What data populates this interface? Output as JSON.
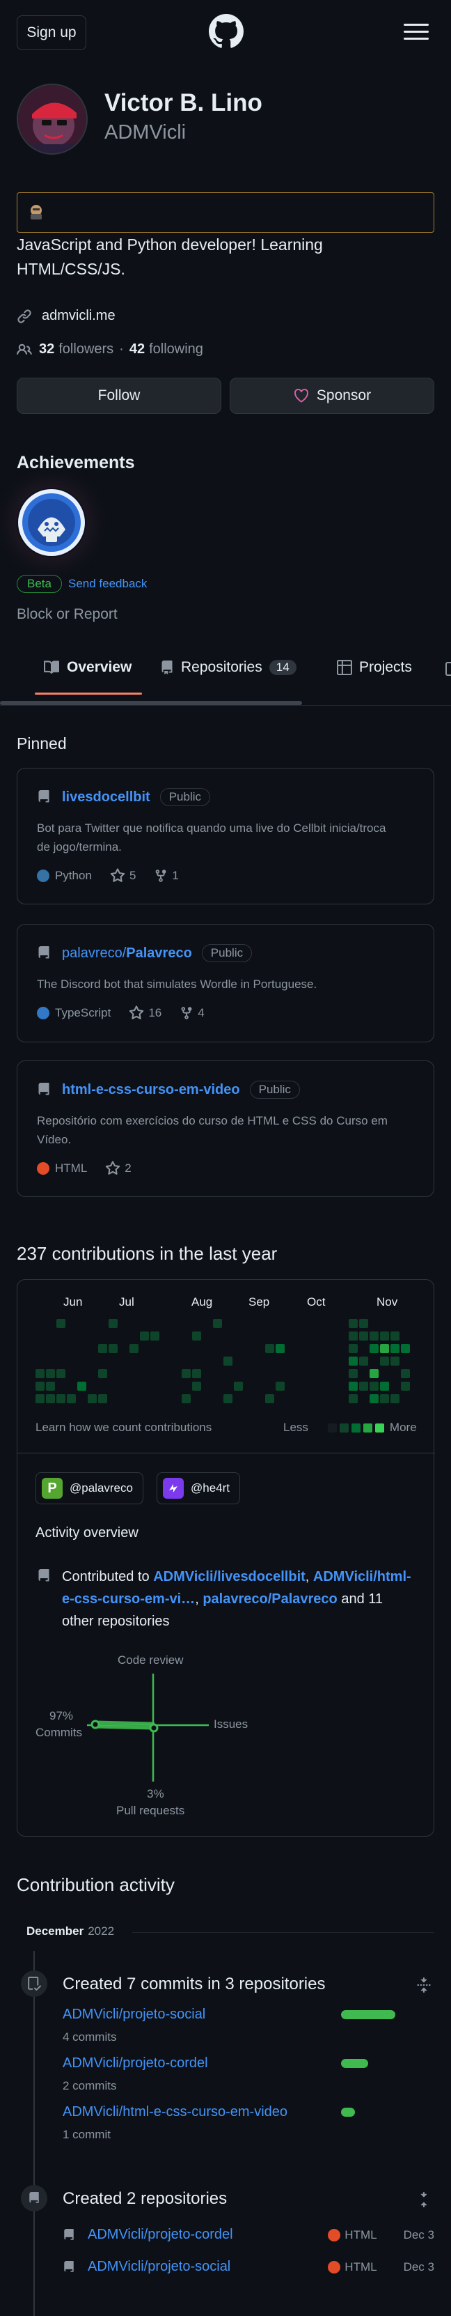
{
  "header": {
    "signup": "Sign up"
  },
  "profile": {
    "name": "Victor B. Lino",
    "login": "ADMVicli",
    "bio": "JavaScript and Python developer! Learning HTML/CSS/JS.",
    "website": "admvicli.me",
    "followers_count": "32",
    "followers_label": "followers",
    "separator": "·",
    "following_count": "42",
    "following_label": "following",
    "follow_btn": "Follow",
    "sponsor_btn": "Sponsor"
  },
  "achievements": {
    "title": "Achievements",
    "beta": "Beta",
    "feedback": "Send feedback",
    "block": "Block or Report"
  },
  "tabs": {
    "overview": "Overview",
    "repositories": "Repositories",
    "repo_count": "14",
    "projects": "Projects"
  },
  "pinned": {
    "title": "Pinned",
    "items": [
      {
        "owner": "",
        "name": "livesdocellbit",
        "visibility": "Public",
        "desc": "Bot para Twitter que notifica quando uma live do Cellbit inicia/troca de jogo/termina.",
        "lang": "Python",
        "lang_color": "#3572A5",
        "stars": "5",
        "forks": "1"
      },
      {
        "owner": "palavreco/",
        "name": "Palavreco",
        "visibility": "Public",
        "desc": "The Discord bot that simulates Wordle in Portuguese.",
        "lang": "TypeScript",
        "lang_color": "#3178c6",
        "stars": "16",
        "forks": "4"
      },
      {
        "owner": "",
        "name": "html-e-css-curso-em-video",
        "visibility": "Public",
        "desc": "Repositório com exercícios do curso de HTML e CSS do Curso em Vídeo.",
        "lang": "HTML",
        "lang_color": "#e34c26",
        "stars": "2",
        "forks": ""
      }
    ]
  },
  "contributions": {
    "title": "237 contributions in the last year",
    "months": [
      "Jun",
      "Jul",
      "Aug",
      "Sep",
      "Oct",
      "Nov"
    ],
    "learn": "Learn how we count contributions",
    "less": "Less",
    "more": "More",
    "orgs": [
      "@palavreco",
      "@he4rt"
    ],
    "activity_title": "Activity overview",
    "contributed_to": "Contributed to",
    "repo1": "ADMVicli/livesdocellbit",
    "repo2": "ADMVicli/html-e-css-curso-em-vi…",
    "repo3": "palavreco/Palavreco",
    "and_others": "and 11 other repositories",
    "code_review": "Code review",
    "issues": "Issues",
    "commits_pct": "97%",
    "commits_label": "Commits",
    "pr_pct": "3%",
    "pr_label": "Pull requests"
  },
  "activity": {
    "title": "Contribution activity",
    "month": "December",
    "year": "2022",
    "commits_title": "Created 7 commits in 3 repositories",
    "commit_repos": [
      {
        "name": "ADMVicli/projeto-social",
        "count": "4 commits",
        "ratio": 1.0
      },
      {
        "name": "ADMVicli/projeto-cordel",
        "count": "2 commits",
        "ratio": 0.5
      },
      {
        "name": "ADMVicli/html-e-css-curso-em-video",
        "count": "1 commit",
        "ratio": 0.25
      }
    ],
    "repos_title": "Created 2 repositories",
    "created_repos": [
      {
        "name": "ADMVicli/projeto-cordel",
        "lang": "HTML",
        "date": "Dec 3"
      },
      {
        "name": "ADMVicli/projeto-social",
        "lang": "HTML",
        "date": "Dec 3"
      }
    ]
  }
}
